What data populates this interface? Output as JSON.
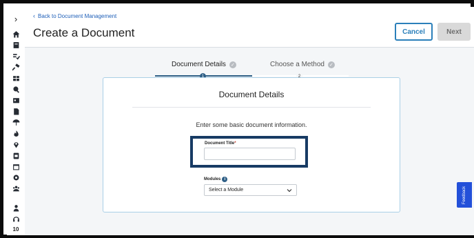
{
  "header": {
    "back_link": "Back to Document Management",
    "title": "Create a Document",
    "cancel_label": "Cancel",
    "next_label": "Next"
  },
  "sidebar": {
    "toggle": "›",
    "items": [
      {
        "icon": "home-icon"
      },
      {
        "icon": "document-stack-icon"
      },
      {
        "icon": "checklist-icon"
      },
      {
        "icon": "hammer-icon"
      },
      {
        "icon": "grid-icon"
      },
      {
        "icon": "search-icon"
      },
      {
        "icon": "id-card-icon"
      },
      {
        "icon": "file-icon"
      },
      {
        "icon": "umbrella-icon"
      },
      {
        "icon": "flame-icon"
      },
      {
        "icon": "location-pin-icon"
      },
      {
        "icon": "clipboard-icon"
      },
      {
        "icon": "calendar-icon"
      },
      {
        "icon": "gear-icon"
      },
      {
        "icon": "group-icon"
      },
      {
        "icon": "user-icon"
      },
      {
        "icon": "headset-icon"
      }
    ],
    "bottom_text": "10"
  },
  "stepper": {
    "steps": [
      {
        "label": "Document Details",
        "number": "1"
      },
      {
        "label": "Choose a Method",
        "number": "2"
      }
    ],
    "check_glyph": "✓"
  },
  "card": {
    "title": "Document Details",
    "description": "Enter some basic document information.",
    "document_title_label": "Document Title",
    "required_marker": "*",
    "document_title_value": "",
    "modules_label": "Modules",
    "modules_info": "i",
    "module_select_value": "Select a Module"
  },
  "feedback_label": "Feedback",
  "colors": {
    "accent": "#2a7fba",
    "highlight_border": "#173b64",
    "stepper_active": "#2e5f86",
    "feedback_bg": "#2350d9",
    "link": "#1e5fb8"
  }
}
